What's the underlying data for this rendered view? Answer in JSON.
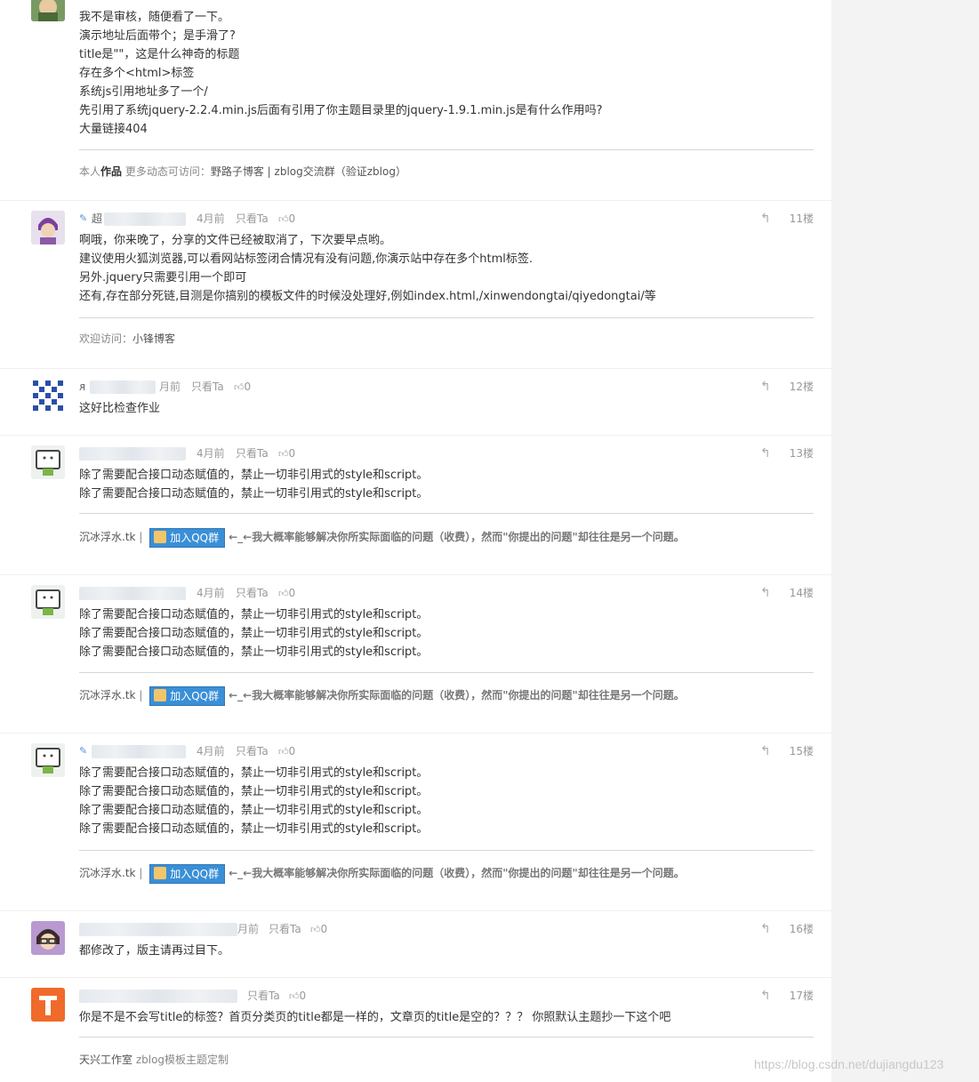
{
  "comments": [
    {
      "lines": [
        "我不是审核，随便看了一下。",
        "演示地址后面带个；是手滑了?",
        "title是\"\"，这是什么神奇的标题",
        "存在多个<html>标签",
        "系统js引用地址多了一个/",
        "先引用了系统jquery-2.2.4.min.js后面有引用了你主题目录里的jquery-1.9.1.min.js是有什么作用吗?",
        "大量链接404"
      ],
      "signature": {
        "prefix": "本人",
        "bold": "作品",
        "middle": " 更多动态可访问：",
        "links": "野路子博客 | zblog交流群（验证zblog）"
      }
    },
    {
      "name_prefix": "超",
      "time": "4月前",
      "only_ta": "只看Ta",
      "likes": "0",
      "floor": "11楼",
      "lines": [
        "啊哦，你来晚了，分享的文件已经被取消了，下次要早点哟。",
        "建议使用火狐浏览器,可以看网站标签闭合情况有没有问题,你演示站中存在多个html标签.",
        "另外.jquery只需要引用一个即可",
        "还有,存在部分死链,目测是你搞别的模板文件的时候没处理好,例如index.html,/xinwendongtai/qiyedongtai/等"
      ],
      "signature": {
        "prefix": "欢迎访问：",
        "links": "小锋博客"
      }
    },
    {
      "time": "月前",
      "only_ta": "只看Ta",
      "likes": "0",
      "floor": "12楼",
      "lines": [
        "这好比检查作业"
      ]
    },
    {
      "time": "4月前",
      "only_ta": "只看Ta",
      "likes": "0",
      "floor": "13楼",
      "lines": [
        "除了需要配合接口动态赋值的，禁止一切非引用式的style和script。",
        "除了需要配合接口动态赋值的，禁止一切非引用式的style和script。"
      ],
      "signature": {
        "site": "沉冰浮水.tk",
        "divider": "|",
        "qq_button": "加入QQ群",
        "tagline": "←_←我大概率能够解决你所实际面临的问题（收费），然而\"你提出的问题\"却往往是另一个问题。"
      }
    },
    {
      "time": "4月前",
      "only_ta": "只看Ta",
      "likes": "0",
      "floor": "14楼",
      "lines": [
        "除了需要配合接口动态赋值的，禁止一切非引用式的style和script。",
        "除了需要配合接口动态赋值的，禁止一切非引用式的style和script。",
        "除了需要配合接口动态赋值的，禁止一切非引用式的style和script。"
      ],
      "signature": {
        "site": "沉冰浮水.tk",
        "divider": "|",
        "qq_button": "加入QQ群",
        "tagline": "←_←我大概率能够解决你所实际面临的问题（收费），然而\"你提出的问题\"却往往是另一个问题。"
      }
    },
    {
      "time": "4月前",
      "only_ta": "只看Ta",
      "likes": "0",
      "floor": "15楼",
      "lines": [
        "除了需要配合接口动态赋值的，禁止一切非引用式的style和script。",
        "除了需要配合接口动态赋值的，禁止一切非引用式的style和script。",
        "除了需要配合接口动态赋值的，禁止一切非引用式的style和script。",
        "除了需要配合接口动态赋值的，禁止一切非引用式的style和script。"
      ],
      "signature": {
        "site": "沉冰浮水.tk",
        "divider": "|",
        "qq_button": "加入QQ群",
        "tagline": "←_←我大概率能够解决你所实际面临的问题（收费），然而\"你提出的问题\"却往往是另一个问题。"
      }
    },
    {
      "time": "月前",
      "only_ta": "只看Ta",
      "likes": "0",
      "floor": "16楼",
      "lines": [
        "都修改了，版主请再过目下。"
      ]
    },
    {
      "only_ta": "只看Ta",
      "likes": "0",
      "floor": "17楼",
      "lines": [
        "你是不是不会写title的标签？首页分类页的title都是一样的，文章页的title是空的？？？ 你照默认主题抄一下这个吧"
      ],
      "signature": {
        "site": "天兴工作室",
        "links": " zblog模板主题定制"
      }
    }
  ],
  "icons": {
    "reply": "reply-icon",
    "like": "thumbs-up-icon",
    "edit": "pencil-icon",
    "qq": "qq-group-icon"
  },
  "watermark": "https://blog.csdn.net/dujiangdu123"
}
